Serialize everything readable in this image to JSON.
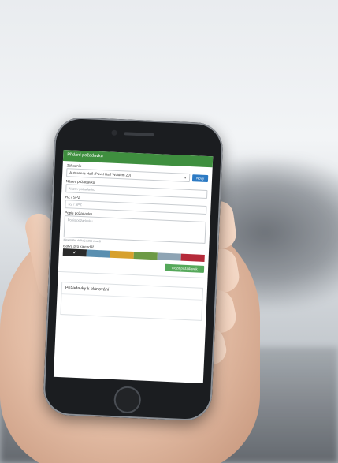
{
  "form": {
    "header_title": "Přidání požadavku",
    "customer_label": "Zákazník",
    "customer_value": "Autoservis Haťl (Pavel Haťl Woldem ZJ)",
    "new_button": "Nový",
    "requirement_name_label": "Název požadavku",
    "requirement_name_placeholder": "Název požadavku",
    "plate_label": "RZ / SPZ",
    "plate_placeholder": "RZ / SPZ",
    "description_label": "Popis požadavku",
    "description_placeholder": "Popis požadavku",
    "description_hint": "Maximální délka je 255 znaků",
    "color_label": "Barva pro kalendář",
    "colors": [
      "#2b2b2b",
      "#5a8fb0",
      "#d7a12e",
      "#6d9a45",
      "#8ea4b4",
      "#b52a3a"
    ],
    "selected_color_index": 0,
    "submit_button": "Vložit požadavek"
  },
  "planning": {
    "title": "Požadavky k plánování"
  }
}
